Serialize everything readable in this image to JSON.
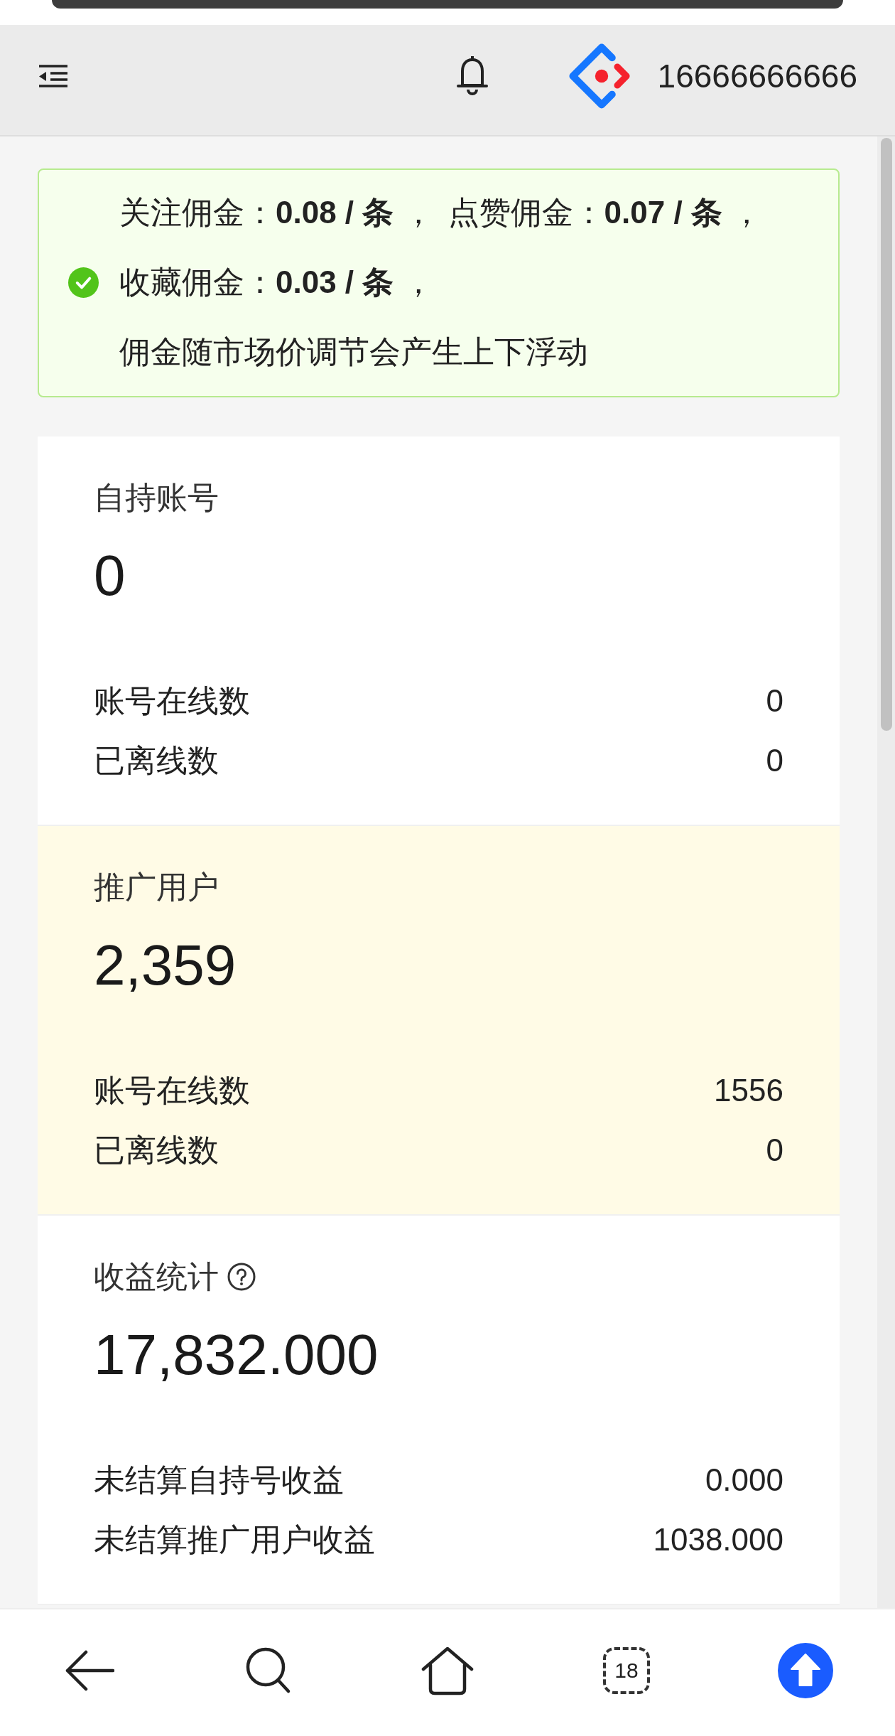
{
  "header": {
    "user": "16666666666"
  },
  "alert": {
    "kind": "success",
    "rates": [
      "关注佣金：**0.08 / 条** ，",
      "点赞佣金：**0.07 / 条** ，",
      "收藏佣金：**0.03 / 条** ，"
    ],
    "note": "佣金随市场价调节会产生上下浮动"
  },
  "cards": [
    {
      "title": "自持账号",
      "help_icon": false,
      "color": "#ffffff",
      "value": "0",
      "rows": [
        {
          "label": "账号在线数",
          "value": "0"
        },
        {
          "label": "已离线数",
          "value": "0"
        }
      ]
    },
    {
      "title": "推广用户",
      "help_icon": false,
      "color": "#fffbe6",
      "value": "2,359",
      "rows": [
        {
          "label": "账号在线数",
          "value": "1556"
        },
        {
          "label": "已离线数",
          "value": "0"
        }
      ]
    },
    {
      "title": "收益统计",
      "help_icon": true,
      "color": "#ffffff",
      "value": "17,832.000",
      "rows": [
        {
          "label": "未结算自持号收益",
          "value": "0.000"
        },
        {
          "label": "未结算推广用户收益",
          "value": "1038.000"
        }
      ]
    }
  ],
  "bottom_bar": {
    "tab_count": "18"
  }
}
